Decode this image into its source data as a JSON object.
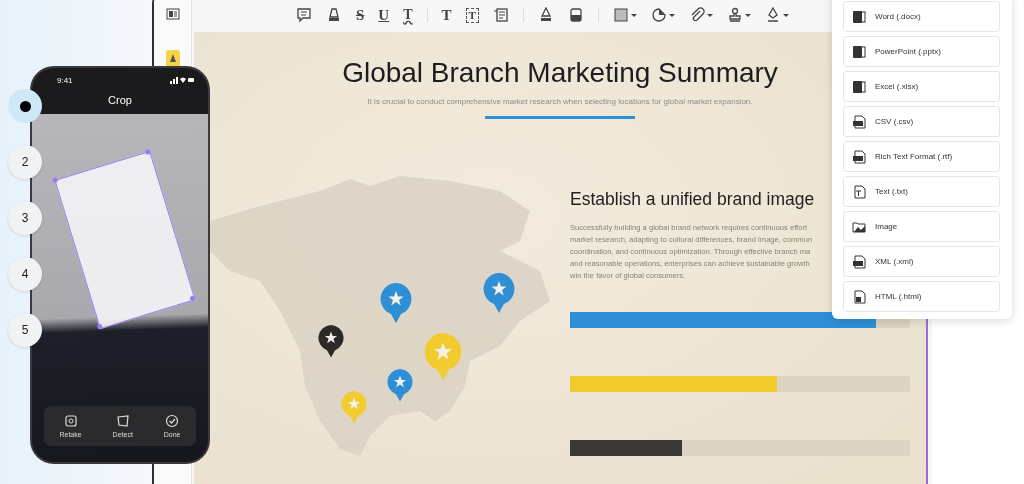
{
  "steps": [
    {
      "selected": true
    },
    {
      "label": "2",
      "selected": false
    },
    {
      "label": "3",
      "selected": false
    },
    {
      "label": "4",
      "selected": false
    },
    {
      "label": "5",
      "selected": false
    }
  ],
  "phone": {
    "time": "9:41",
    "title": "Crop",
    "actions": [
      {
        "kind": "retake",
        "label": "Retake"
      },
      {
        "kind": "detect",
        "label": "Detect"
      },
      {
        "kind": "done",
        "label": "Done"
      }
    ]
  },
  "toolbar": {
    "tools": [
      {
        "kind": "comment",
        "dropdown": false
      },
      {
        "kind": "highlight",
        "dropdown": false
      },
      {
        "kind": "strikethrough",
        "glyph": "S",
        "dropdown": false
      },
      {
        "kind": "underline",
        "glyph": "U",
        "dropdown": false
      },
      {
        "kind": "squiggly",
        "glyph": "T",
        "dropdown": false
      },
      {
        "kind": "separator"
      },
      {
        "kind": "text",
        "glyph": "T",
        "dropdown": false
      },
      {
        "kind": "textbox",
        "glyph": "T",
        "dropdown": false
      },
      {
        "kind": "note",
        "dropdown": false
      },
      {
        "kind": "separator"
      },
      {
        "kind": "pencil",
        "dropdown": false
      },
      {
        "kind": "eraser",
        "dropdown": false
      },
      {
        "kind": "separator"
      },
      {
        "kind": "shape",
        "dropdown": true
      },
      {
        "kind": "sticker",
        "dropdown": true
      },
      {
        "kind": "attach",
        "dropdown": true
      },
      {
        "kind": "stamp",
        "dropdown": true
      },
      {
        "kind": "signature",
        "dropdown": true
      }
    ]
  },
  "document": {
    "title": "Global Branch Marketing Summary",
    "subtitle": "It is crucial to conduct comprehensive market research when selecting locations for global market expansion.",
    "heading": "Establish a unified brand image",
    "paragraph_lines": [
      "Successfully building a global brand network requires continuous effort",
      "market research, adapting to cultural differences, brand image, commun",
      "coordination, and continuous optimization. Through effective branch ma",
      "and reasonable operations, enterprises can achieve sustainable growth",
      "win the favor of global consumers."
    ],
    "pins": [
      {
        "color": "#2f8fd6"
      },
      {
        "color": "#2f8fd6"
      },
      {
        "color": "#2b2a28"
      },
      {
        "color": "#f2cb2f"
      },
      {
        "color": "#2f8fd6"
      },
      {
        "color": "#f2cb2f"
      }
    ],
    "bars": [
      {
        "color": "#2f8fd6",
        "level": 0.9
      },
      {
        "color": "#f2cb2f",
        "level": 0.61
      },
      {
        "color": "#3a3835",
        "level": 0.33
      }
    ]
  },
  "export_menu": {
    "items": [
      {
        "kind": "word",
        "label": "Word (.docx)"
      },
      {
        "kind": "powerpoint",
        "label": "PowerPoint (.pptx)"
      },
      {
        "kind": "excel",
        "label": "Excel (.xlsx)"
      },
      {
        "kind": "csv",
        "label": "CSV (.csv)"
      },
      {
        "kind": "rtf",
        "label": "Rich Text Format (.rtf)"
      },
      {
        "kind": "txt",
        "label": "Text (.txt)"
      },
      {
        "kind": "image",
        "label": "Image"
      },
      {
        "kind": "xml",
        "label": "XML (.xml)"
      },
      {
        "kind": "html",
        "label": "HTML (.html)"
      }
    ]
  }
}
